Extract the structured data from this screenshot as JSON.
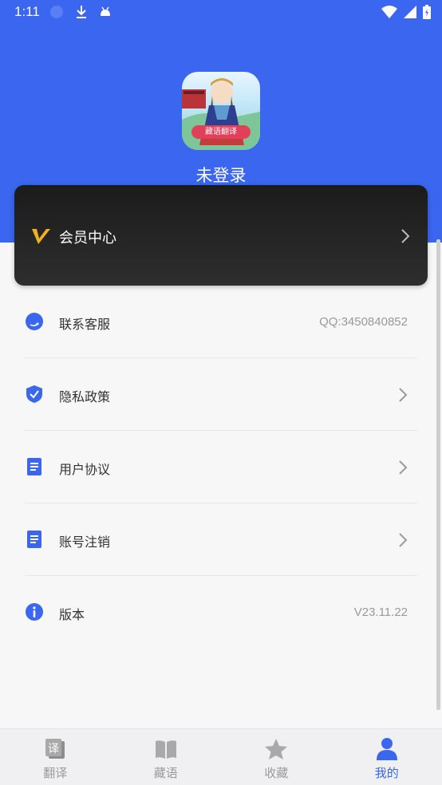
{
  "status_bar": {
    "time": "1:11"
  },
  "profile": {
    "logo_text": "藏语翻译",
    "login_status": "未登录"
  },
  "vip": {
    "label": "会员中心"
  },
  "menu": [
    {
      "label": "联系客服",
      "value": "QQ:3450840852",
      "icon": "headset-icon"
    },
    {
      "label": "隐私政策",
      "value": "",
      "icon": "shield-icon"
    },
    {
      "label": "用户协议",
      "value": "",
      "icon": "document-icon"
    },
    {
      "label": "账号注销",
      "value": "",
      "icon": "document-icon"
    },
    {
      "label": "版本",
      "value": "V23.11.22",
      "icon": "info-icon"
    }
  ],
  "nav": [
    {
      "label": "翻译",
      "icon": "translate-icon",
      "active": false
    },
    {
      "label": "藏语",
      "icon": "book-icon",
      "active": false
    },
    {
      "label": "收藏",
      "icon": "star-icon",
      "active": false
    },
    {
      "label": "我的",
      "icon": "person-icon",
      "active": true
    }
  ],
  "colors": {
    "primary": "#3a66f0",
    "vip_gold": "#f2b01e",
    "card_dark": "#222222"
  }
}
